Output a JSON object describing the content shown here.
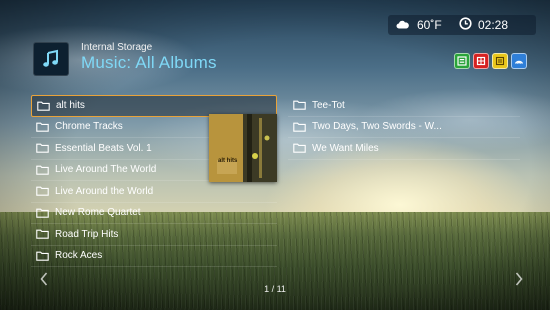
{
  "header": {
    "subtitle": "Internal Storage",
    "title": "Music: All Albums",
    "icon": "music-note-icon"
  },
  "status": {
    "weather_icon": "cloud-icon",
    "temperature": "60˚F",
    "clock_icon": "clock-icon",
    "time": "02:28"
  },
  "color_keys": [
    {
      "name": "green",
      "color": "#2aa43a"
    },
    {
      "name": "red",
      "color": "#d62222"
    },
    {
      "name": "yellow",
      "color": "#e9c71b"
    },
    {
      "name": "blue",
      "color": "#2f7fd8"
    }
  ],
  "albums": {
    "left": [
      {
        "label": "alt hits",
        "selected": true
      },
      {
        "label": "Chrome Tracks"
      },
      {
        "label": "Essential Beats Vol. 1"
      },
      {
        "label": "Live Around The World"
      },
      {
        "label": "Live Around the World"
      },
      {
        "label": "New Rome Quartet"
      },
      {
        "label": "Road Trip Hits"
      },
      {
        "label": "Rock Aces"
      }
    ],
    "right": [
      {
        "label": "Tee-Tot"
      },
      {
        "label": "Two Days, Two Swords - W..."
      },
      {
        "label": "We Want Miles"
      }
    ]
  },
  "cover_art_text": "alt hits",
  "pagination": "1 / 11"
}
